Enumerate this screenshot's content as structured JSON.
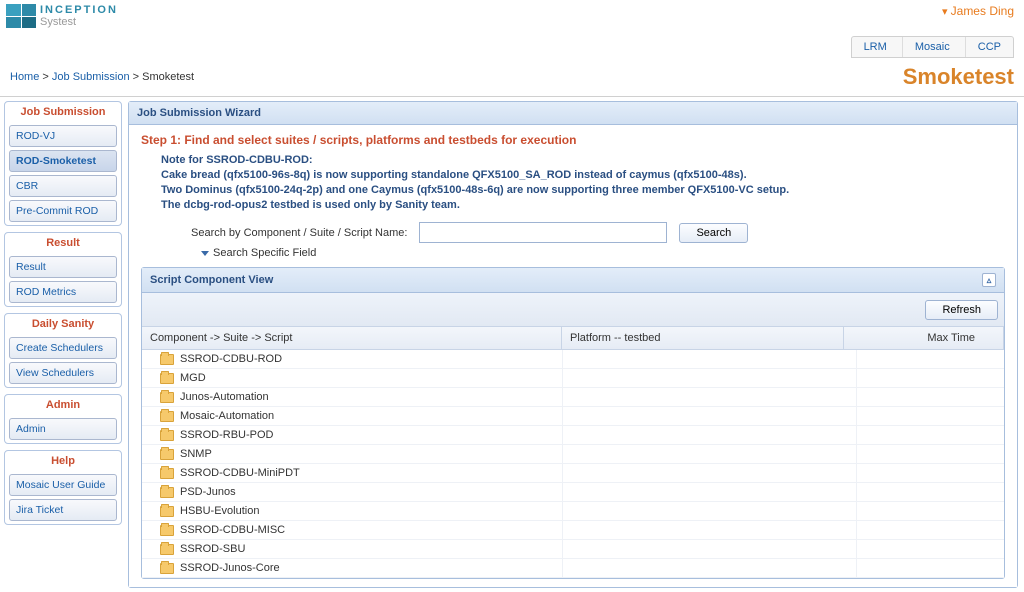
{
  "brand": {
    "name": "INCEPTION",
    "sub": "Systest"
  },
  "user": {
    "name": "James Ding"
  },
  "topnav": {
    "items": [
      "LRM",
      "Mosaic",
      "CCP"
    ]
  },
  "breadcrumb": {
    "home": "Home",
    "sep": ">",
    "jobSubmission": "Job Submission",
    "current": "Smoketest"
  },
  "pageTitle": "Smoketest",
  "sidebar": {
    "groups": [
      {
        "title": "Job Submission",
        "items": [
          "ROD-VJ",
          "ROD-Smoketest",
          "CBR",
          "Pre-Commit ROD"
        ],
        "activeIndex": 1
      },
      {
        "title": "Result",
        "items": [
          "Result",
          "ROD Metrics"
        ]
      },
      {
        "title": "Daily Sanity",
        "items": [
          "Create Schedulers",
          "View Schedulers"
        ]
      },
      {
        "title": "Admin",
        "items": [
          "Admin"
        ]
      },
      {
        "title": "Help",
        "items": [
          "Mosaic User Guide",
          "Jira Ticket"
        ]
      }
    ]
  },
  "wizard": {
    "header": "Job Submission Wizard",
    "stepTitle": "Step 1: Find and select suites / scripts, platforms and testbeds for execution",
    "noteHeading": "Note for SSROD-CDBU-ROD:",
    "noteLines": [
      "Cake bread (qfx5100-96s-8q) is now supporting standalone QFX5100_SA_ROD instead of caymus (qfx5100-48s).",
      "Two Dominus (qfx5100-24q-2p) and one Caymus (qfx5100-48s-6q) are now supporting three member QFX5100-VC setup.",
      "The dcbg-rod-opus2 testbed is used only by Sanity team."
    ],
    "searchLabel": "Search by Component / Suite / Script Name:",
    "searchValue": "",
    "searchBtn": "Search",
    "specificField": "Search Specific Field"
  },
  "grid": {
    "title": "Script Component View",
    "refresh": "Refresh",
    "columns": {
      "c1": "Component -> Suite -> Script",
      "c2": "Platform -- testbed",
      "c3": "Max Time"
    },
    "rows": [
      "SSROD-CDBU-ROD",
      "MGD",
      "Junos-Automation",
      "Mosaic-Automation",
      "SSROD-RBU-POD",
      "SNMP",
      "SSROD-CDBU-MiniPDT",
      "PSD-Junos",
      "HSBU-Evolution",
      "SSROD-CDBU-MISC",
      "SSROD-SBU",
      "SSROD-Junos-Core"
    ]
  }
}
